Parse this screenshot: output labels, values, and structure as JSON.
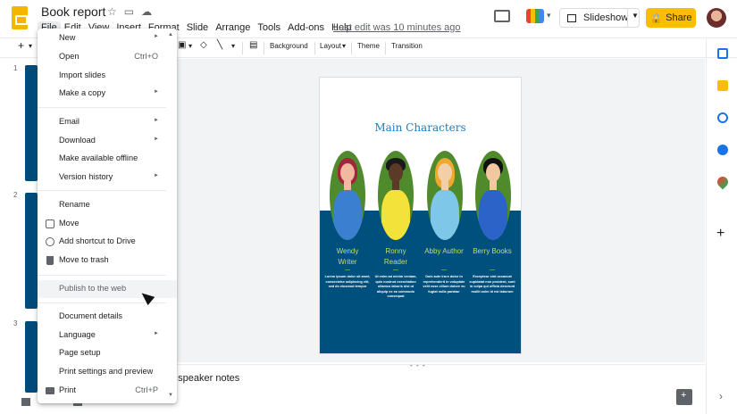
{
  "header": {
    "title": "Book report",
    "menu": [
      "File",
      "Edit",
      "View",
      "Insert",
      "Format",
      "Slide",
      "Arrange",
      "Tools",
      "Add-ons",
      "Help"
    ],
    "active_menu": "File",
    "last_edit": "Last edit was 10 minutes ago",
    "slideshow_label": "Slideshow",
    "share_label": "Share"
  },
  "toolbar": {
    "background_label": "Background",
    "layout_label": "Layout",
    "theme_label": "Theme",
    "transition_label": "Transition"
  },
  "filmstrip": {
    "slide_numbers": [
      "1",
      "2",
      "3"
    ]
  },
  "file_menu": {
    "items": [
      {
        "label": "New",
        "arrow": true
      },
      {
        "label": "Open",
        "shortcut": "Ctrl+O"
      },
      {
        "label": "Import slides"
      },
      {
        "label": "Make a copy",
        "arrow": true
      },
      {
        "label": "Email",
        "arrow": true
      },
      {
        "label": "Download",
        "arrow": true
      },
      {
        "label": "Make available offline"
      },
      {
        "label": "Version history",
        "arrow": true
      },
      {
        "label": "Rename"
      },
      {
        "label": "Move",
        "icon": "move-icon"
      },
      {
        "label": "Add shortcut to Drive",
        "icon": "drive-shortcut-icon"
      },
      {
        "label": "Move to trash",
        "icon": "trash-icon"
      },
      {
        "label": "Publish to the web",
        "highlighted": true
      },
      {
        "label": "Document details"
      },
      {
        "label": "Language",
        "arrow": true
      },
      {
        "label": "Page setup"
      },
      {
        "label": "Print settings and preview"
      },
      {
        "label": "Print",
        "shortcut": "Ctrl+P",
        "icon": "print-icon"
      }
    ],
    "arrow_glyph": "►"
  },
  "slide": {
    "title": "Main Characters",
    "characters": [
      {
        "name_line1": "Wendy",
        "name_line2": "Writer",
        "bio": "Lorem ipsum dolor sit amet, consectetur adipiscing elit, sed do eiusmod tempor"
      },
      {
        "name_line1": "Ronny",
        "name_line2": "Reader",
        "bio": "Ut enim ad minim veniam, quis nostrud exercitation ullamco laboris nisi ut aliquip ex ea commodo consequat"
      },
      {
        "name_line1": "Abby Author",
        "name_line2": "",
        "bio": "Duis aute irure dolor in reprehenderit in voluptate velit esse cillum dolore eu fugiat nulla pariatur"
      },
      {
        "name_line1": "Berry Books",
        "name_line2": "",
        "bio": "Excepteur sint occaecat cupidatat non proident, sunt in culpa qui officia deserunt mollit anim id est laborum"
      }
    ],
    "colors": {
      "band": "#00507e",
      "title": "#1f7cc1",
      "name": "#c5df61",
      "avatar_bg": "#4f8a2c"
    }
  },
  "notes": {
    "placeholder": "d speaker notes"
  },
  "brand": {
    "share": "#fbbc04"
  }
}
